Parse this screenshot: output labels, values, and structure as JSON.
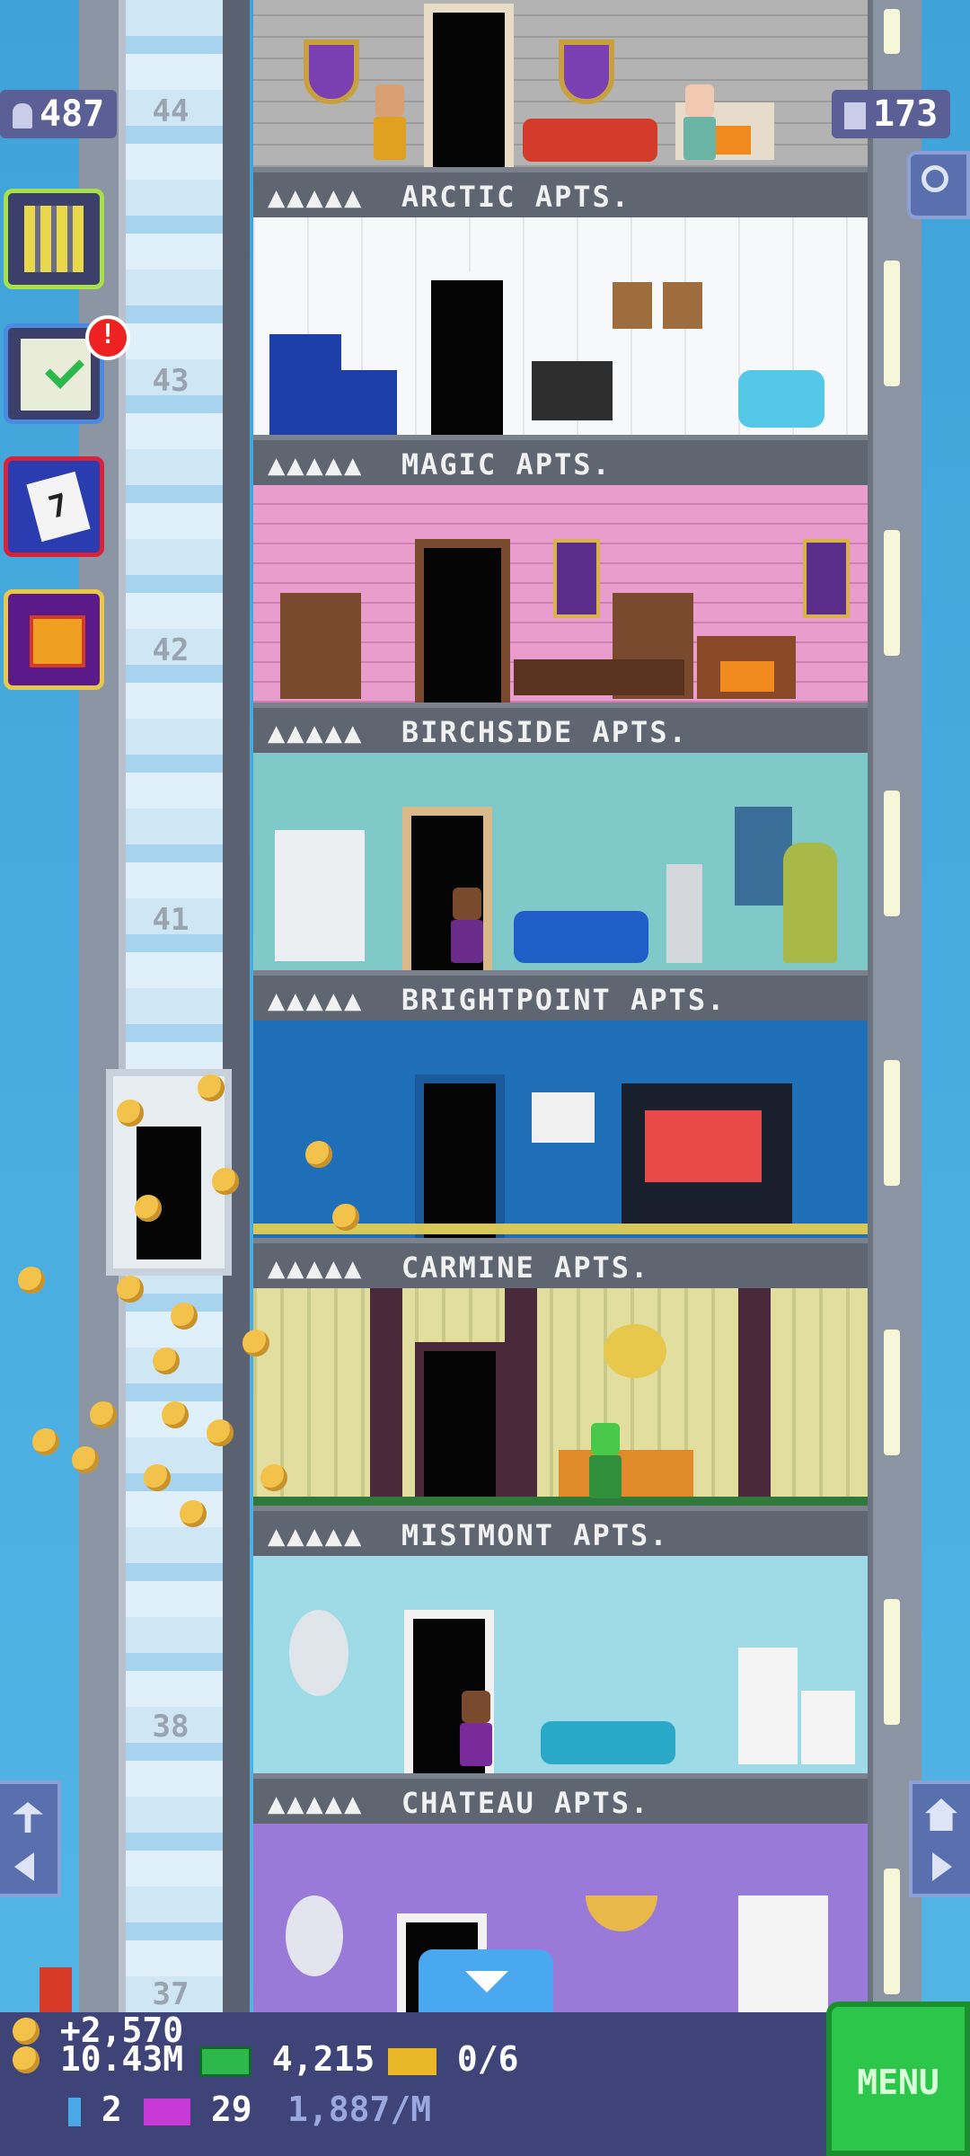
{
  "hud": {
    "population": "487",
    "floors": "173"
  },
  "side_buttons": {
    "tasks_badge": "!",
    "calendar_day": "7"
  },
  "floor_numbers": [
    "44",
    "43",
    "42",
    "41",
    "38",
    "37"
  ],
  "floors": [
    {
      "name": "ARCTIC APTS.",
      "stars": "▲▲▲▲▲"
    },
    {
      "name": "MAGIC APTS.",
      "stars": "▲▲▲▲▲"
    },
    {
      "name": "BIRCHSIDE APTS.",
      "stars": "▲▲▲▲▲"
    },
    {
      "name": "BRIGHTPOINT APTS.",
      "stars": "▲▲▲▲▲"
    },
    {
      "name": "CARMINE APTS.",
      "stars": "▲▲▲▲▲"
    },
    {
      "name": "MISTMONT APTS.",
      "stars": "▲▲▲▲▲"
    },
    {
      "name": "CHATEAU APTS.",
      "stars": "▲▲▲▲▲"
    }
  ],
  "bottom": {
    "coin_gain": "+2,570",
    "coins": "10.43M",
    "bux": "4,215",
    "tickets": "0/6",
    "keys": "2",
    "vip": "29",
    "rate": "1,887/M",
    "menu": "MENU"
  },
  "colors": {
    "hud_chip": "#5a5f96",
    "menu_green": "#2cc64a",
    "bottom_bar": "#3e4477"
  }
}
